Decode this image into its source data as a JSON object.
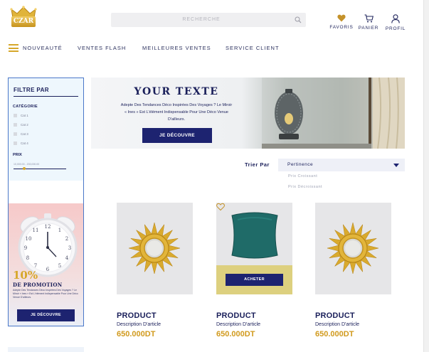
{
  "brand": {
    "logo_text": "CZAR"
  },
  "search": {
    "placeholder": "RECHERCHE"
  },
  "header": {
    "favoris": "FAVORIS",
    "panier": "PANIER",
    "profil": "PROFIL"
  },
  "nav": {
    "items": [
      "NOUVEAUTÉ",
      "VENTES FLASH",
      "MEILLEURES VENTES",
      "SERVICE CLIENT"
    ]
  },
  "sidebar": {
    "title": "FILTRE PAR",
    "category_label": "CATÉGORIE",
    "categories": [
      "Cat 1",
      "Cat 2",
      "Cat 3",
      "Cat 4"
    ],
    "price_label": "PRIX",
    "price_range": "10,000.00 - 200,000.00",
    "promo": {
      "percent": "10%",
      "title": "DE PROMOTION",
      "text": "Adepte Des Tendances Déco Inspirées Des Voyages ? Le Miroir « Ines » Est L'élément Indispensable Pour Une Déco Venue D'ailleurs.",
      "button": "JE DÉCOUVRE"
    }
  },
  "hero": {
    "title": "YOUR TEXTE",
    "text": "Adepte Des Tendances Déco Inspirées Des Voyages ? Le Miroir « Ines » Est L'élément Indispensable Pour Une Déco Venue D'ailleurs.",
    "button": "JE DÉCOUVRE"
  },
  "sort": {
    "label": "Trier Par",
    "selected": "Pertinence",
    "options": [
      "Prix Croissant",
      "Prix Décroissant"
    ]
  },
  "products": [
    {
      "name": "PRODUCT",
      "description": "Description D'article",
      "price": "650.000DT",
      "image": "sun-mirror"
    },
    {
      "name": "PRODUCT",
      "description": "Description D'article",
      "price": "650.000DT",
      "image": "green-cushion",
      "action": "ACHETER"
    },
    {
      "name": "PRODUCT",
      "description": "Description D'article",
      "price": "650.000DT",
      "image": "sun-mirror"
    }
  ],
  "colors": {
    "navy": "#1d2370",
    "gold": "#d6a72a",
    "price": "#d19a1d",
    "sidebar_border": "#4a78c9"
  }
}
